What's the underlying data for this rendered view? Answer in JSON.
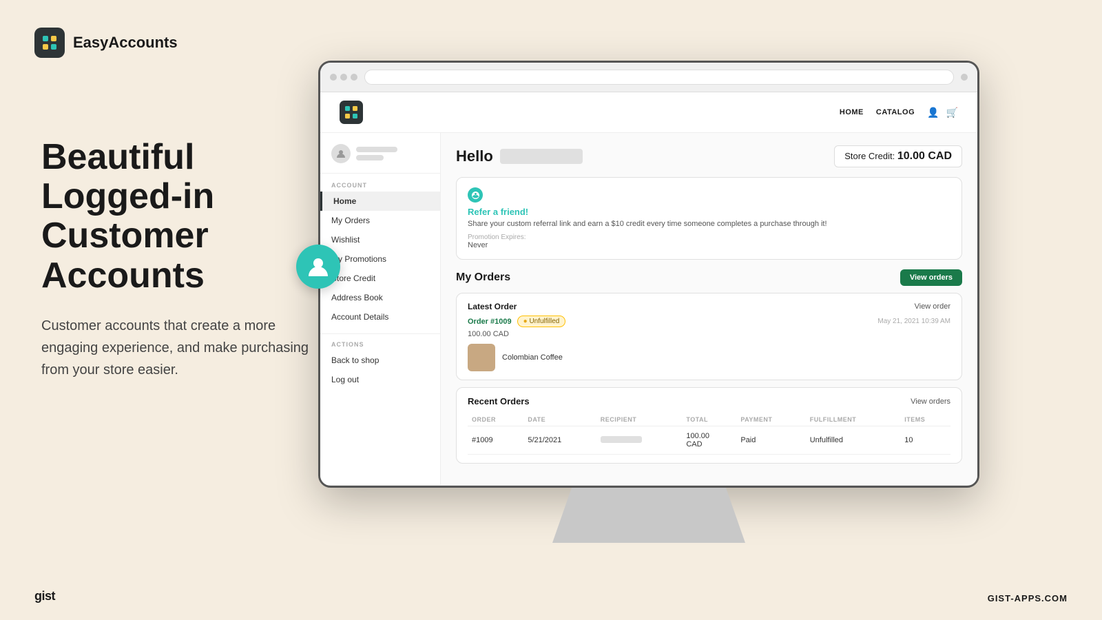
{
  "app": {
    "name": "EasyAccounts",
    "bottom_left": "gist",
    "bottom_right": "GIST-APPS.COM"
  },
  "marketing": {
    "headline": "Beautiful Logged-in Customer Accounts",
    "description": "Customer accounts that create a more engaging experience, and make purchasing from your store easier."
  },
  "browser": {
    "addressbar_placeholder": ""
  },
  "store_nav": {
    "links": [
      "HOME",
      "CATALOG"
    ],
    "home": "HOME",
    "catalog": "CATALOG"
  },
  "sidebar": {
    "section_account": "ACCOUNT",
    "section_actions": "ACTIONS",
    "items": [
      {
        "label": "Home",
        "active": true
      },
      {
        "label": "My Orders",
        "active": false
      },
      {
        "label": "Wishlist",
        "active": false
      },
      {
        "label": "My Promotions",
        "active": false
      },
      {
        "label": "Store Credit",
        "active": false
      },
      {
        "label": "Address Book",
        "active": false
      },
      {
        "label": "Account Details",
        "active": false
      }
    ],
    "action_items": [
      {
        "label": "Back to shop"
      },
      {
        "label": "Log out"
      }
    ]
  },
  "main": {
    "hello_text": "Hello",
    "store_credit_label": "Store Credit:",
    "store_credit_amount": "10.00 CAD",
    "referral": {
      "title": "Refer a friend!",
      "description": "Share your custom referral link and earn a $10 credit every time someone completes a purchase through it!",
      "expires_label": "Promotion Expires:",
      "expires_value": "Never"
    },
    "my_orders": {
      "title": "My Orders",
      "view_orders_btn": "View orders",
      "latest_order": {
        "label": "Latest Order",
        "view_link": "View order",
        "order_number": "Order #1009",
        "badge": "Unfulfilled",
        "date": "May 21, 2021 10:39 AM",
        "amount": "100.00 CAD",
        "product_name": "Colombian Coffee"
      },
      "recent_orders": {
        "title": "Recent Orders",
        "view_link": "View orders",
        "columns": [
          "ORDER",
          "DATE",
          "RECIPIENT",
          "TOTAL",
          "PAYMENT",
          "FULFILLMENT",
          "ITEMS"
        ],
        "rows": [
          {
            "order": "#1009",
            "date": "5/21/2021",
            "recipient": "",
            "total": "100.00 CAD",
            "payment": "Paid",
            "fulfillment": "Unfulfilled",
            "items": "10"
          }
        ]
      }
    }
  }
}
